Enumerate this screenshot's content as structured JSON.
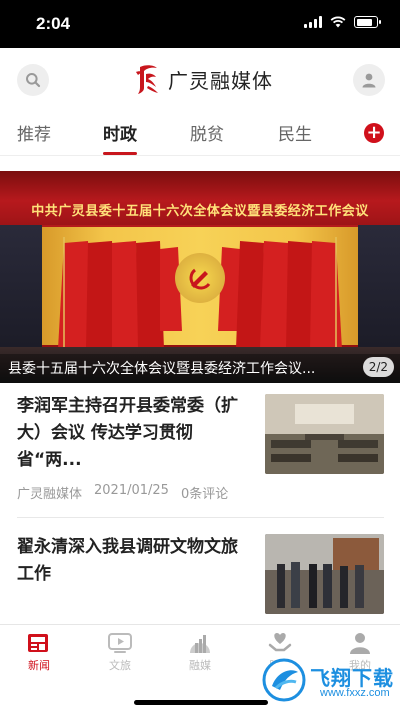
{
  "status_bar": {
    "time": "2:04"
  },
  "header": {
    "app_name": "广灵融媒体",
    "brand_color": "#c8161d",
    "search_icon": "search-icon",
    "user_icon": "user-icon"
  },
  "tabs": [
    {
      "label": "推荐",
      "active": false
    },
    {
      "label": "时政",
      "active": true
    },
    {
      "label": "脱贫",
      "active": false
    },
    {
      "label": "民生",
      "active": false
    }
  ],
  "banner": {
    "headline": "中共广灵县委十五届十六次全体会议暨县委经济工作会议",
    "caption": "县委十五届十六次全体会议暨县委经济工作会议...",
    "page_indicator": "2/2"
  },
  "news": [
    {
      "title": "李润军主持召开县委常委（扩大）会议 传达学习贯彻省“两...",
      "source": "广灵融媒体",
      "date": "2021/01/25",
      "comments": "0条评论"
    },
    {
      "title": "翟永清深入我县调研文物文旅工作"
    }
  ],
  "bottom_nav": [
    {
      "label": "新闻",
      "icon": "newspaper-icon",
      "active": true
    },
    {
      "label": "文旅",
      "icon": "play-icon",
      "active": false
    },
    {
      "label": "融媒",
      "icon": "chart-icon",
      "active": false
    },
    {
      "label": "服务",
      "icon": "heart-hand-icon",
      "active": false
    },
    {
      "label": "我的",
      "icon": "user-icon",
      "active": false
    }
  ],
  "watermark": {
    "text": "飞翔下载",
    "url": "www.fxxz.com"
  }
}
